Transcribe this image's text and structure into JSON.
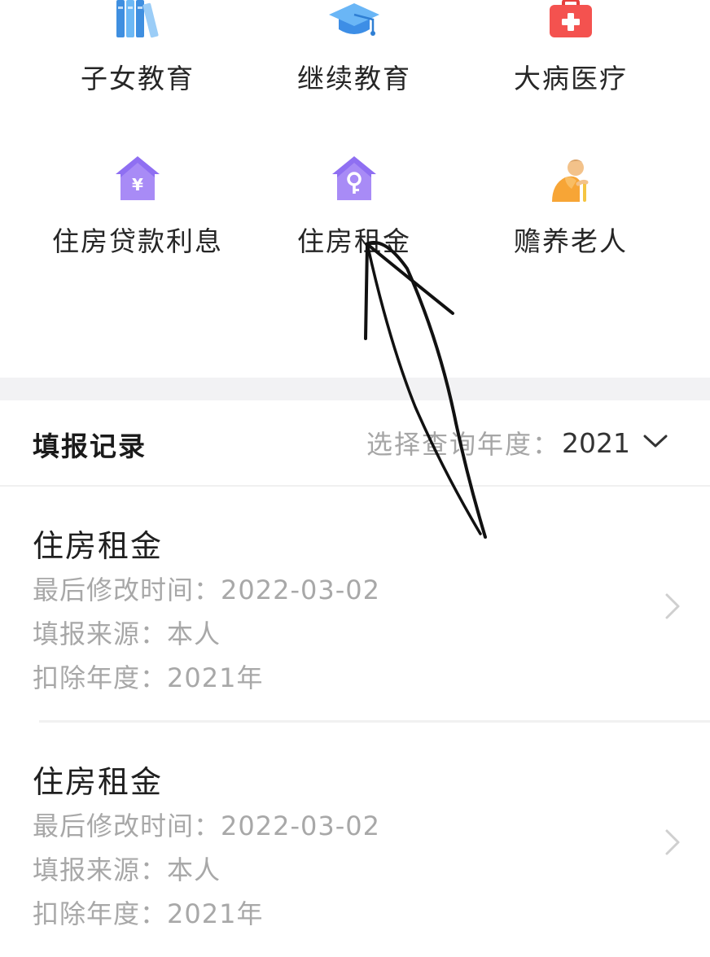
{
  "categories": [
    {
      "id": "child-education",
      "label": "子女教育",
      "icon": "books-icon"
    },
    {
      "id": "continuing-education",
      "label": "继续教育",
      "icon": "graduation-cap-icon"
    },
    {
      "id": "serious-illness",
      "label": "大病医疗",
      "icon": "medical-kit-icon"
    },
    {
      "id": "housing-loan",
      "label": "住房贷款利息",
      "icon": "house-yen-icon"
    },
    {
      "id": "housing-rent",
      "label": "住房租金",
      "icon": "house-key-icon"
    },
    {
      "id": "elderly-support",
      "label": "赡养老人",
      "icon": "elderly-person-icon"
    }
  ],
  "records_section": {
    "title": "填报记录",
    "year_select_label": "选择查询年度：",
    "year_value": "2021"
  },
  "records": [
    {
      "title": "住房租金",
      "modified_label": "最后修改时间：",
      "modified_value": "2022-03-02",
      "source_label": "填报来源：",
      "source_value": "本人",
      "year_label": "扣除年度：",
      "year_value": "2021年"
    },
    {
      "title": "住房租金",
      "modified_label": "最后修改时间：",
      "modified_value": "2022-03-02",
      "source_label": "填报来源：",
      "source_value": "本人",
      "year_label": "扣除年度：",
      "year_value": "2021年"
    }
  ],
  "colors": {
    "blue_icon": "#4aa3f0",
    "red_icon": "#f4524f",
    "purple_icon": "#8f6ff2",
    "orange_icon": "#f7a536",
    "muted_text": "#a8a8a8",
    "band_gray": "#f2f2f4"
  }
}
